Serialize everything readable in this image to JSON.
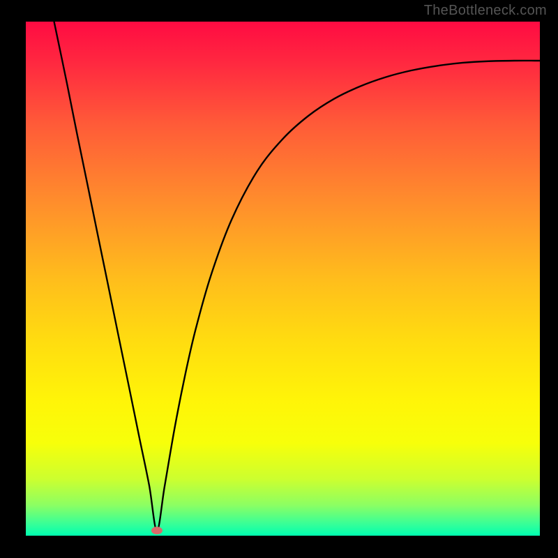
{
  "watermark": "TheBottleneck.com",
  "chart_data": {
    "type": "line",
    "title": "",
    "xlabel": "",
    "ylabel": "",
    "xlim": [
      0,
      100
    ],
    "ylim": [
      0,
      100
    ],
    "grid": false,
    "legend": false,
    "annotations": [],
    "background_gradient": {
      "stops": [
        {
          "offset": 0.0,
          "color": "#ff0b42"
        },
        {
          "offset": 0.08,
          "color": "#ff2840"
        },
        {
          "offset": 0.2,
          "color": "#ff5b38"
        },
        {
          "offset": 0.35,
          "color": "#ff8d2c"
        },
        {
          "offset": 0.5,
          "color": "#ffbd1c"
        },
        {
          "offset": 0.62,
          "color": "#ffdc10"
        },
        {
          "offset": 0.74,
          "color": "#fff508"
        },
        {
          "offset": 0.82,
          "color": "#f7ff0a"
        },
        {
          "offset": 0.89,
          "color": "#ccff2f"
        },
        {
          "offset": 0.94,
          "color": "#8dff62"
        },
        {
          "offset": 0.975,
          "color": "#3cff95"
        },
        {
          "offset": 1.0,
          "color": "#00ffb0"
        }
      ]
    },
    "marker": {
      "x": 25.5,
      "y": 1.0,
      "color": "#d86b6b"
    },
    "series": [
      {
        "name": "curve",
        "color": "#000000",
        "x": [
          5.5,
          8,
          10,
          12,
          14,
          16,
          18,
          20,
          22,
          24,
          25.5,
          27,
          29,
          31,
          33,
          36,
          40,
          45,
          50,
          55,
          60,
          65,
          70,
          75,
          80,
          85,
          90,
          95,
          100
        ],
        "y": [
          100,
          88,
          78,
          68.3,
          58.5,
          48.8,
          39,
          29.3,
          19.5,
          9.8,
          1.0,
          9.6,
          21.2,
          31.3,
          40.0,
          50.6,
          61.4,
          70.9,
          77.2,
          81.7,
          85.0,
          87.4,
          89.2,
          90.5,
          91.4,
          92.0,
          92.3,
          92.4,
          92.4
        ]
      }
    ]
  }
}
